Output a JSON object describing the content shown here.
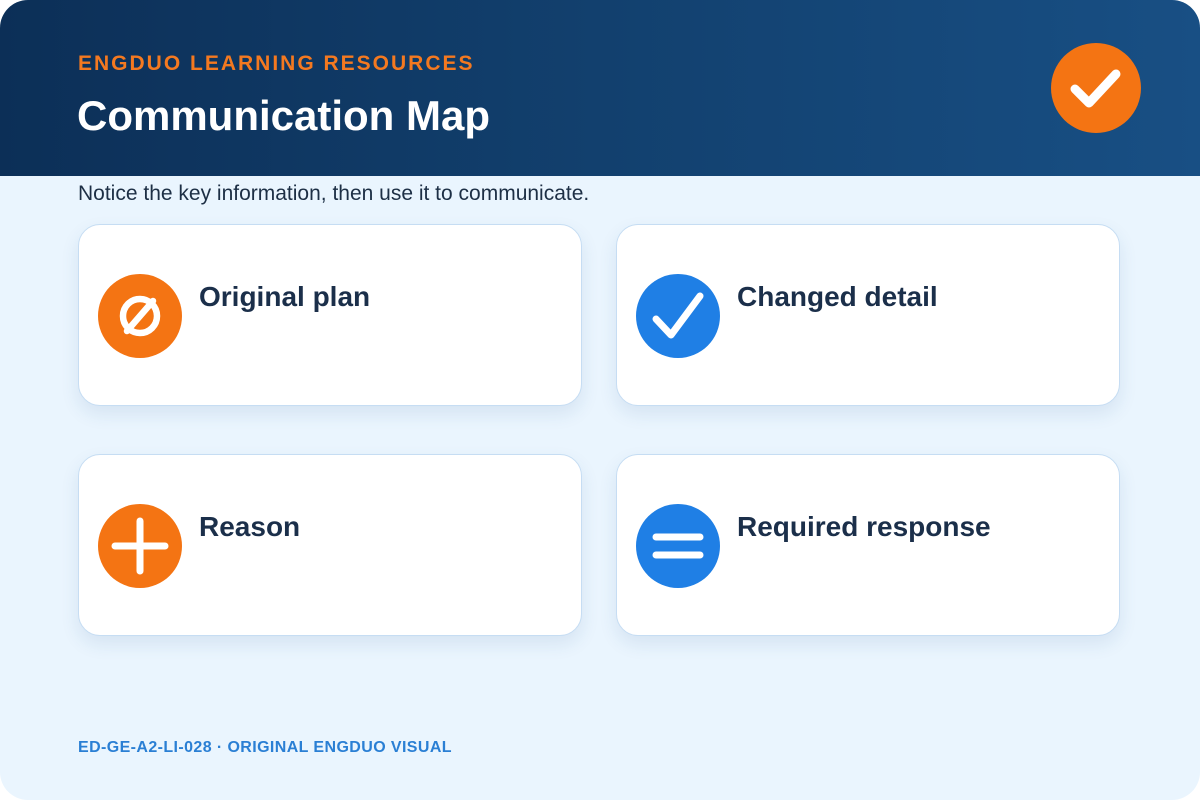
{
  "header": {
    "eyebrow": "ENGDUO LEARNING RESOURCES",
    "title": "Communication Map",
    "badge_icon": "check-icon"
  },
  "subtitle": "Notice the key information, then use it to communicate.",
  "cards": [
    {
      "label": "Original plan",
      "icon": "empty-set-icon",
      "color": "#f47413"
    },
    {
      "label": "Changed detail",
      "icon": "check-icon",
      "color": "#1f7fe5"
    },
    {
      "label": "Reason",
      "icon": "plus-icon",
      "color": "#f47413"
    },
    {
      "label": "Required response",
      "icon": "equals-icon",
      "color": "#1f7fe5"
    }
  ],
  "footer": "ED-GE-A2-LI-028 · ORIGINAL ENGDUO VISUAL",
  "colors": {
    "accent_orange": "#f47413",
    "accent_blue": "#1f7fe5",
    "header_dark": "#0c2f57",
    "background": "#eaf5fe"
  }
}
